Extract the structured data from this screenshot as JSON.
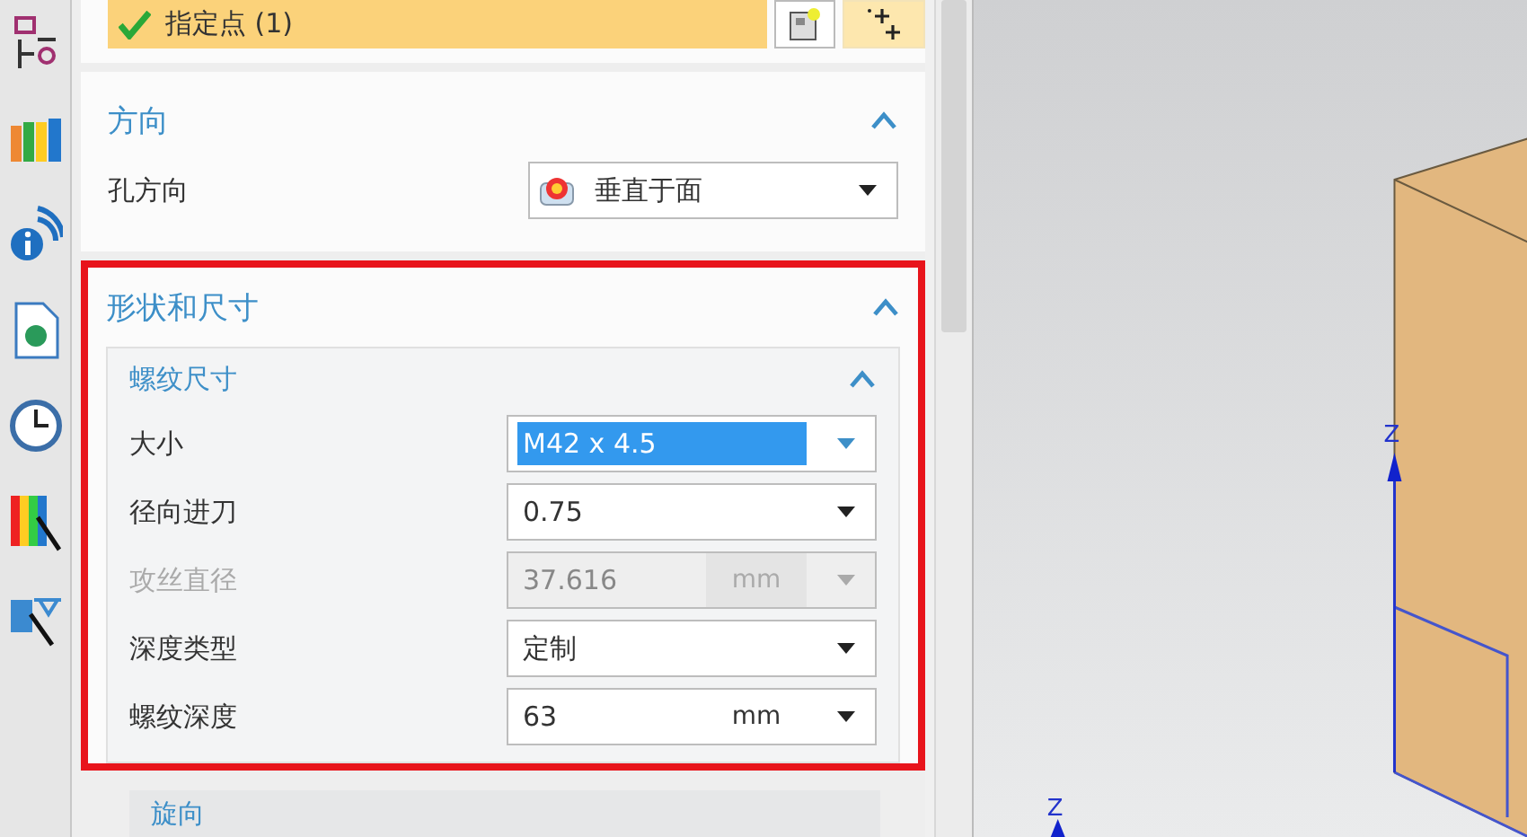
{
  "point_selector": {
    "label": "指定点 (1)",
    "done": true
  },
  "direction": {
    "title": "方向",
    "expanded": true,
    "rows": [
      {
        "label": "孔方向",
        "value": "垂直于面"
      }
    ]
  },
  "shape_size": {
    "title": "形状和尺寸",
    "expanded": true,
    "highlighted": true,
    "thread_size": {
      "title": "螺纹尺寸",
      "expanded": true,
      "rows": [
        {
          "label": "大小",
          "value": "M42 x 4.5",
          "selected": true,
          "disabled": false
        },
        {
          "label": "径向进刀",
          "value": "0.75",
          "selected": false,
          "disabled": false
        },
        {
          "label": "攻丝直径",
          "value": "37.616",
          "unit": "mm",
          "selected": false,
          "disabled": true
        },
        {
          "label": "深度类型",
          "value": "定制",
          "selected": false,
          "disabled": false
        },
        {
          "label": "螺纹深度",
          "value": "63",
          "unit": "mm",
          "selected": false,
          "disabled": false
        }
      ]
    },
    "rotation": {
      "title": "旋向"
    }
  },
  "viewport": {
    "axis_labels": [
      "Z",
      "Z"
    ]
  }
}
